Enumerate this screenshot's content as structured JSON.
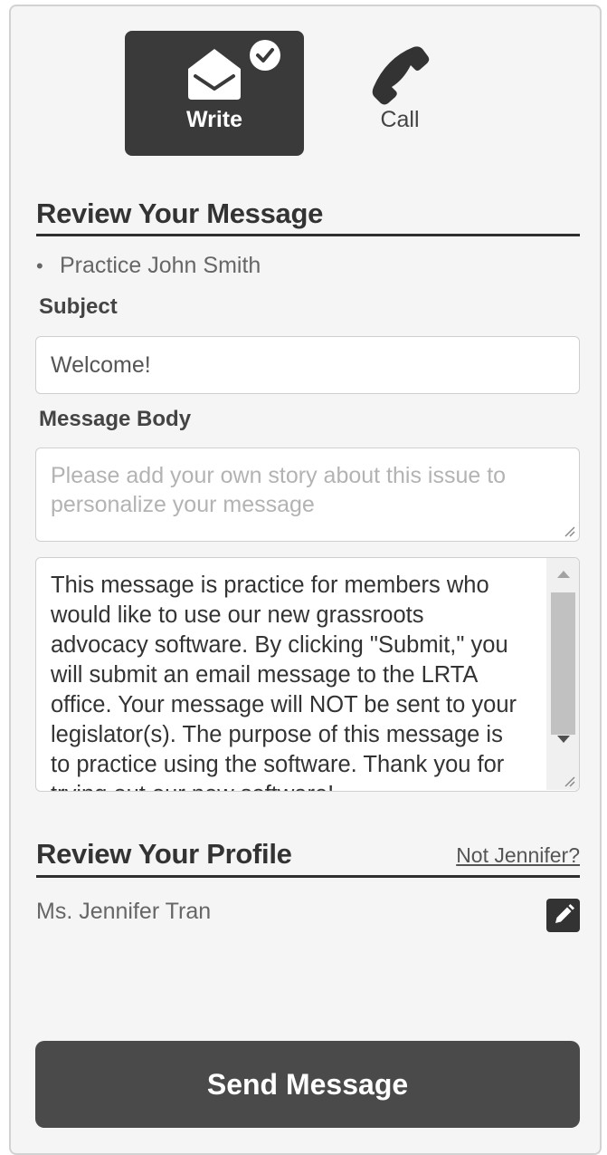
{
  "tabs": {
    "write_label": "Write",
    "call_label": "Call"
  },
  "review_message": {
    "title": "Review Your Message",
    "recipient": "Practice John Smith",
    "subject_label": "Subject",
    "subject_value": "Welcome!",
    "body_label": "Message Body",
    "story_placeholder": "Please add your own story about this issue to personalize your message",
    "message_text": "This message is practice for members who would like to use our new grassroots advocacy software. By clicking \"Submit,\" you will submit an email message to the LRTA office. Your message will NOT be sent to your legislator(s). The purpose of this message is to practice using the software. Thank you for trying out our new software!"
  },
  "review_profile": {
    "title": "Review Your Profile",
    "not_link": "Not Jennifer?",
    "name": "Ms. Jennifer Tran"
  },
  "send_button_label": "Send Message",
  "colors": {
    "dark": "#3a3a3a",
    "button": "#4a4a4a",
    "panel": "#f5f5f5"
  }
}
